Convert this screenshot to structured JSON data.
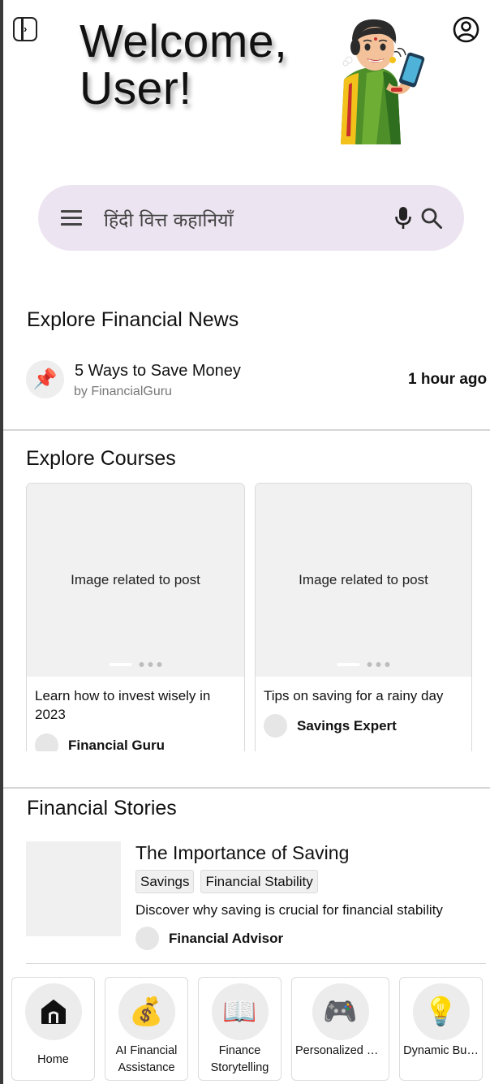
{
  "header": {
    "welcome_line1": "Welcome,",
    "welcome_line2": "User!",
    "sidebar_toggle_icon": "sidebar-toggle-icon",
    "account_icon": "account-circle-icon",
    "mascot": "woman-on-phone-illustration"
  },
  "search": {
    "menu_icon": "menu-icon",
    "query": "हिंदी वित्त कहानियाँ",
    "mic_icon": "microphone-icon",
    "search_icon": "search-icon"
  },
  "news": {
    "section_title": "Explore Financial News",
    "items": [
      {
        "icon": "pushpin-icon",
        "title": "5 Ways to Save Money",
        "author": "by FinancialGuru",
        "time": "1 hour ago"
      }
    ]
  },
  "courses": {
    "section_title": "Explore Courses",
    "items": [
      {
        "image_text": "Image related to post",
        "description": "Learn how to invest wisely in 2023",
        "author": "Financial Guru"
      },
      {
        "image_text": "Image related to post",
        "description": "Tips on saving for a rainy day",
        "author": "Savings Expert"
      }
    ]
  },
  "stories": {
    "section_title": "Financial Stories",
    "items": [
      {
        "title": "The Importance of Saving",
        "tags": [
          "Savings",
          "Financial Stability"
        ],
        "description": "Discover why saving is crucial for financial stability",
        "author": "Financial Advisor"
      }
    ]
  },
  "bottom_nav": {
    "items": [
      {
        "label": "Home",
        "icon": "home-icon"
      },
      {
        "label": "AI Financial Assistance",
        "icon": "money-bag-icon"
      },
      {
        "label": "Finance Storytelling",
        "icon": "open-book-icon"
      },
      {
        "label": "Personalized D…",
        "icon": "game-controller-icon"
      },
      {
        "label": "Dynamic Bu…",
        "icon": "light-bulb-icon"
      }
    ]
  },
  "colors": {
    "search_bg": "#ede4f1",
    "placeholder_bg": "#f1f1f1",
    "divider": "#d6d6d6"
  }
}
